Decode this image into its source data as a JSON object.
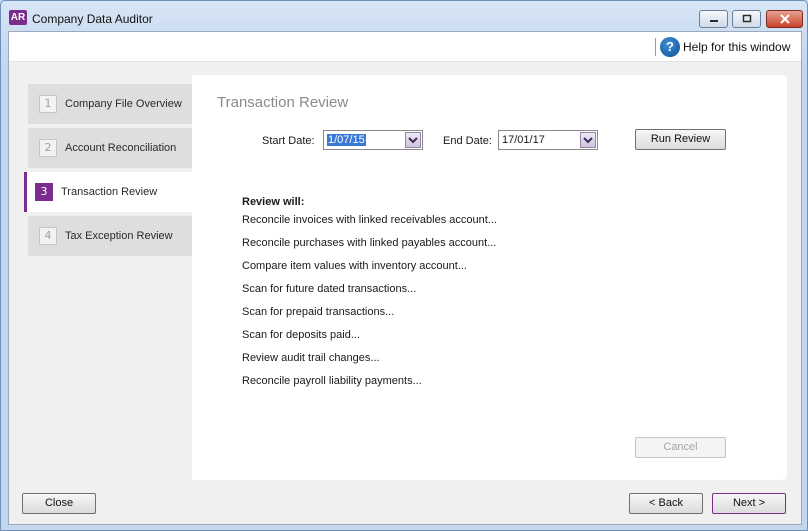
{
  "window": {
    "app_icon_text": "AR",
    "title": "Company Data Auditor"
  },
  "helpbar": {
    "icon_glyph": "?",
    "label": "Help for this window"
  },
  "steps": [
    {
      "num": "1",
      "label": "Company File Overview",
      "active": false
    },
    {
      "num": "2",
      "label": "Account Reconciliation",
      "active": false
    },
    {
      "num": "3",
      "label": "Transaction Review",
      "active": true
    },
    {
      "num": "4",
      "label": "Tax Exception Review",
      "active": false
    }
  ],
  "panel": {
    "title": "Transaction Review",
    "start_date_label": "Start Date:",
    "start_date_value": "1/07/15",
    "end_date_label": "End Date:",
    "end_date_value": "17/01/17",
    "run_review_label": "Run Review",
    "review_heading": "Review will:",
    "review_items": [
      "Reconcile invoices with linked receivables account...",
      "Reconcile purchases with linked payables account...",
      "Compare item values with inventory account...",
      "Scan for future dated transactions...",
      "Scan for prepaid transactions...",
      "Scan for deposits paid...",
      "Review audit trail changes...",
      "Reconcile payroll liability payments..."
    ],
    "cancel_label": "Cancel"
  },
  "footer": {
    "close_label": "Close",
    "back_label": "< Back",
    "next_label": "Next >"
  },
  "colors": {
    "accent": "#7b2d8e",
    "selection": "#3a78d6"
  }
}
